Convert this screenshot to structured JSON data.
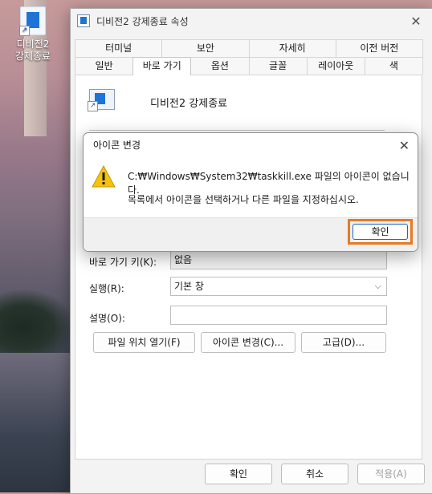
{
  "desktop": {
    "icon_label_line1": "디비전2",
    "icon_label_line2": "강제종료"
  },
  "window": {
    "title": "디비전2 강제종료 속성",
    "tabs_back": [
      "터미널",
      "보안",
      "자세히",
      "이전 버전"
    ],
    "tabs_front": [
      "일반",
      "바로 가기",
      "옵션",
      "글꼴",
      "레이아웃",
      "색"
    ],
    "active_tab": "바로 가기",
    "shortcut_name": "디비전2 강제종료",
    "fields": {
      "hotkey_label": "바로 가기 키(K):",
      "hotkey_value": "없음",
      "run_label": "실행(R):",
      "run_value": "기본 창",
      "comment_label": "설명(O):",
      "comment_value": ""
    },
    "buttons": {
      "open_location": "파일 위치 열기(F)",
      "change_icon": "아이콘 변경(C)...",
      "advanced": "고급(D)..."
    },
    "footer": {
      "ok": "확인",
      "cancel": "취소",
      "apply": "적용(A)"
    }
  },
  "dialog": {
    "title": "아이콘 변경",
    "message_line1": "C:₩Windows₩System32₩taskkill.exe 파일의 아이콘이 없습니다.",
    "message_line2": "목록에서 아이콘을 선택하거나 다른 파일을 지정하십시오.",
    "ok": "확인",
    "highlight_color": "#e57a25"
  }
}
